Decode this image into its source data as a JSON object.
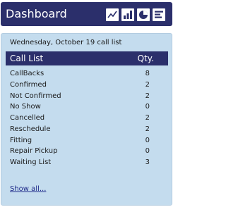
{
  "header": {
    "title": "Dashboard",
    "buttons": [
      {
        "icon": "line-chart-icon"
      },
      {
        "icon": "bar-chart-icon"
      },
      {
        "icon": "pie-chart-icon"
      },
      {
        "icon": "list-view-icon"
      }
    ]
  },
  "panel": {
    "date_label": "Wednesday, October 19 call list",
    "columns": {
      "name": "Call List",
      "qty": "Qty."
    },
    "rows": [
      {
        "name": "CallBacks",
        "qty": "8"
      },
      {
        "name": "Confirmed",
        "qty": "2"
      },
      {
        "name": "Not Confirmed",
        "qty": "2"
      },
      {
        "name": "No Show",
        "qty": "0"
      },
      {
        "name": "Cancelled",
        "qty": "2"
      },
      {
        "name": "Reschedule",
        "qty": "2"
      },
      {
        "name": "Fitting",
        "qty": "0"
      },
      {
        "name": "Repair Pickup",
        "qty": "0"
      },
      {
        "name": "Waiting List",
        "qty": "3"
      }
    ],
    "show_all": "Show all..."
  },
  "colors": {
    "header_bg": "#2b2f6b",
    "panel_bg": "#c4dcee",
    "link": "#1f2a8a"
  }
}
